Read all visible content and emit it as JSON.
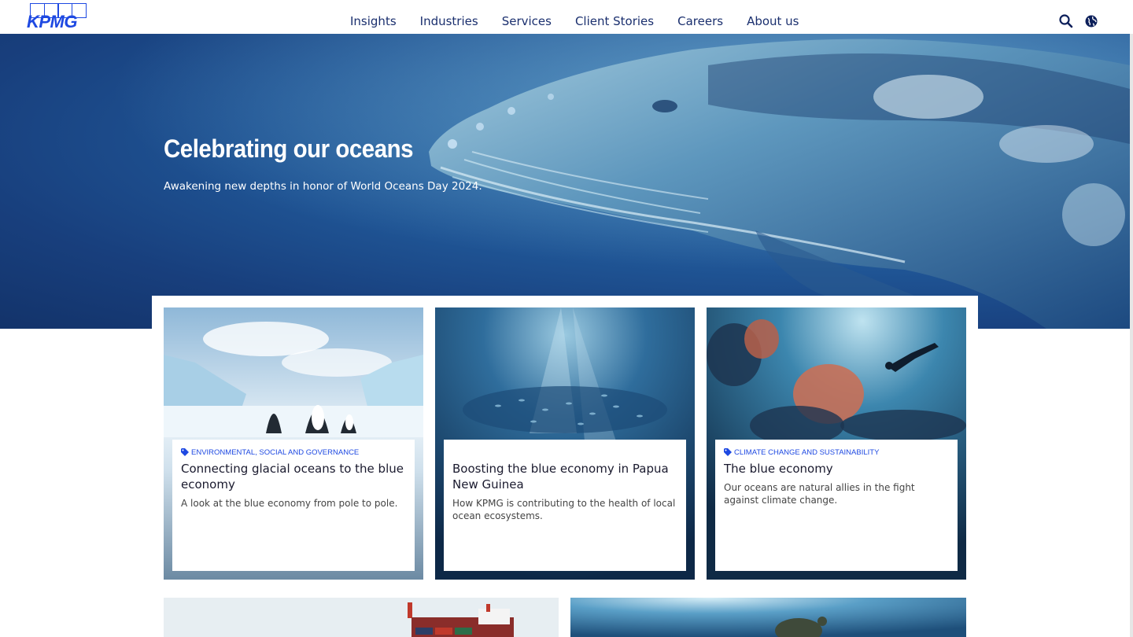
{
  "header": {
    "logo_text": "KPMG",
    "nav": [
      "Insights",
      "Industries",
      "Services",
      "Client Stories",
      "Careers",
      "About us"
    ],
    "icons": [
      "search-icon",
      "globe-icon"
    ]
  },
  "hero": {
    "title": "Celebrating our oceans",
    "subtitle": "Awakening new depths in honor of World Oceans Day 2024."
  },
  "cards": [
    {
      "tag": "ENVIRONMENTAL, SOCIAL AND GOVERNANCE",
      "title": "Connecting glacial oceans to the blue economy",
      "description": "A look at the blue economy from pole to pole."
    },
    {
      "tag": "",
      "title": "Boosting the blue economy in Papua New Guinea",
      "description": "How KPMG is contributing to the health of local ocean ecosystems."
    },
    {
      "tag": "CLIMATE CHANGE AND SUSTAINABILITY",
      "title": "The blue economy",
      "description": "Our oceans are natural allies in the fight against climate change."
    }
  ],
  "colors": {
    "brand_blue": "#1e49e2",
    "nav_text": "#1a2f6e",
    "hero_deep": "#13336a"
  }
}
